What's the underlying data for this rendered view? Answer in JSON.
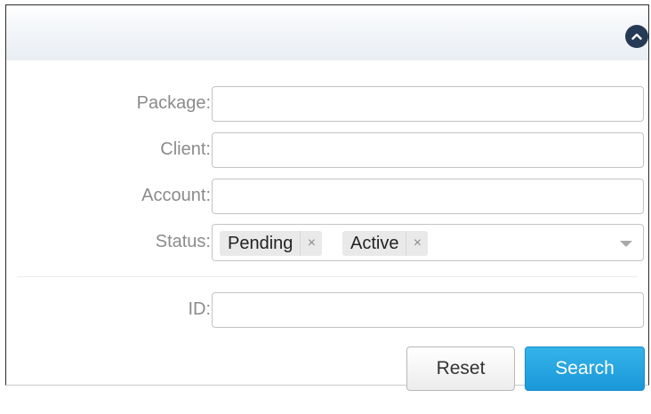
{
  "filter": {
    "package": {
      "label": "Package:",
      "value": "",
      "placeholder": ""
    },
    "client": {
      "label": "Client:",
      "value": "",
      "placeholder": ""
    },
    "account": {
      "label": "Account:",
      "value": "",
      "placeholder": ""
    },
    "status": {
      "label": "Status:",
      "tags": [
        "Pending",
        "Active"
      ],
      "remove_glyph": "×"
    },
    "id": {
      "label": "ID:",
      "value": "",
      "placeholder": ""
    }
  },
  "buttons": {
    "reset_label": "Reset",
    "search_label": "Search"
  },
  "icons": {
    "collapse": "chevron-up-icon",
    "dropdown": "caret-down-icon",
    "tag_remove": "close-icon"
  },
  "colors": {
    "search_button": "#1a98d8",
    "collapse_button": "#253a55",
    "label_text": "#8b8b8b"
  }
}
